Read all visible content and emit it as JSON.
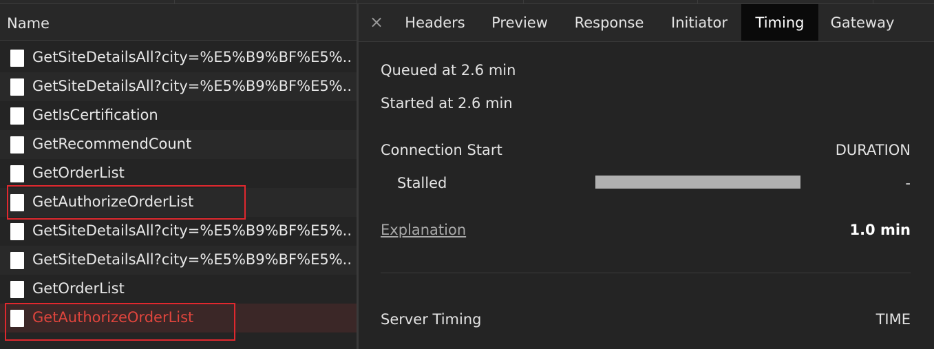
{
  "network_list": {
    "header": "Name",
    "rows": [
      {
        "label": "GetSiteDetailsAll?city=%E5%B9%BF%E5%..."
      },
      {
        "label": "GetSiteDetailsAll?city=%E5%B9%BF%E5%..."
      },
      {
        "label": "GetIsCertification"
      },
      {
        "label": "GetRecommendCount"
      },
      {
        "label": "GetOrderList"
      },
      {
        "label": "GetAuthorizeOrderList"
      },
      {
        "label": "GetSiteDetailsAll?city=%E5%B9%BF%E5%..."
      },
      {
        "label": "GetSiteDetailsAll?city=%E5%B9%BF%E5%..."
      },
      {
        "label": "GetOrderList"
      },
      {
        "label": "GetAuthorizeOrderList"
      }
    ]
  },
  "detail": {
    "close_icon": "×",
    "tabs": [
      "Headers",
      "Preview",
      "Response",
      "Initiator",
      "Timing",
      "Gateway"
    ],
    "active_tab": "Timing",
    "timing": {
      "queued": "Queued at 2.6 min",
      "started": "Started at 2.6 min",
      "connection_start": "Connection Start",
      "duration_header": "DURATION",
      "stalled_label": "Stalled",
      "stalled_value": "-",
      "explanation": "Explanation",
      "total": "1.0 min",
      "server_timing": "Server Timing",
      "time_header": "TIME"
    }
  },
  "colors": {
    "highlight_box": "#e0282e",
    "selected_text": "#e0453d",
    "active_tab_bg": "#0a0a0a"
  }
}
